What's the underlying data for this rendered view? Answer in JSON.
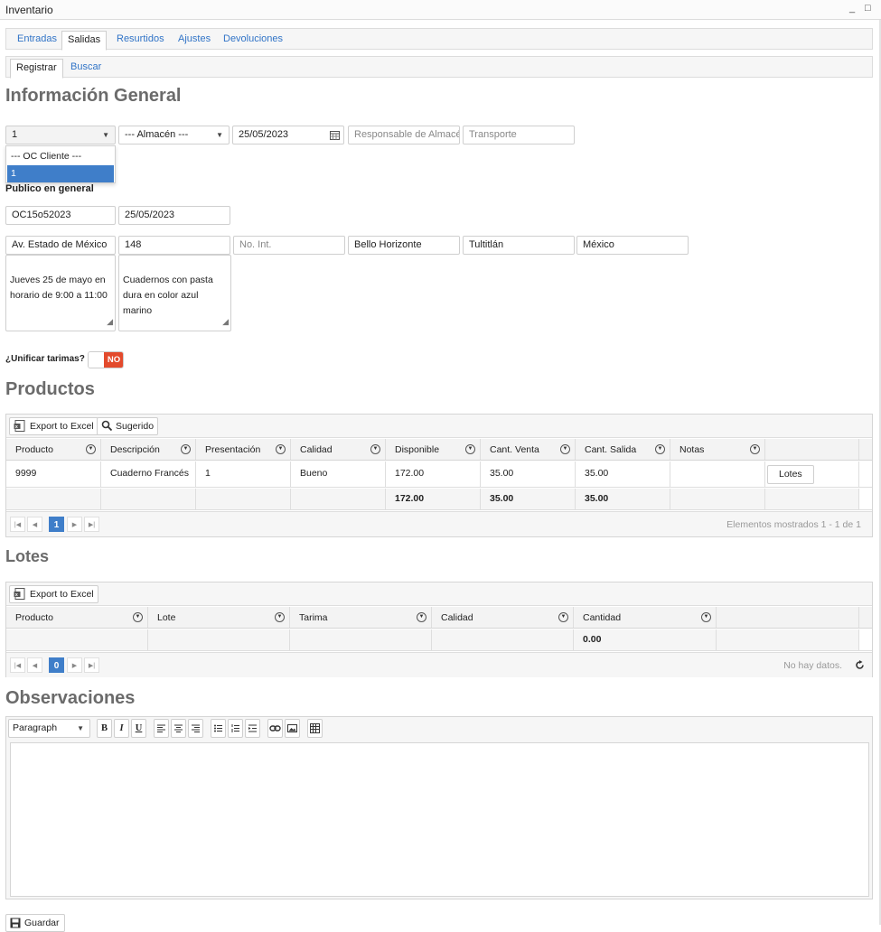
{
  "window": {
    "title": "Inventario",
    "minimize": "_",
    "maximize": "□"
  },
  "tabs": [
    {
      "label": "Entradas"
    },
    {
      "label": "Salidas"
    },
    {
      "label": "Resurtidos"
    },
    {
      "label": "Ajustes"
    },
    {
      "label": "Devoluciones"
    }
  ],
  "subtabs": [
    {
      "label": "Registrar"
    },
    {
      "label": "Buscar"
    }
  ],
  "sections": {
    "general": "Información General",
    "productos": "Productos",
    "lotes": "Lotes",
    "observaciones": "Observaciones"
  },
  "form": {
    "oc_select": "1",
    "almacen": "--- Almacén ---",
    "fecha": "25/05/2023",
    "responsable_placeholder": "Responsable de Almacén",
    "transporte_placeholder": "Transporte",
    "dropdown_options": [
      "--- OC Cliente ---",
      "1"
    ],
    "cliente": "Publico en general",
    "oc_numero": "OC15o52023",
    "fecha_oc": "25/05/2023",
    "calle": "Av. Estado de México",
    "num_ext": "148",
    "num_int_placeholder": "No. Int.",
    "colonia": "Bello Horizonte",
    "municipio": "Tultitlán",
    "estado": "México",
    "nota_entrega": "Jueves 25 de mayo en\nhorario de 9:00  a 11:00",
    "nota_producto": "Cuadernos con pasta\ndura en color azul marino",
    "unificar_label": "¿Unificar tarimas?",
    "unificar_value": "NO"
  },
  "productos": {
    "toolbar": {
      "export": "Export to Excel",
      "sugerido": "Sugerido"
    },
    "columns": [
      "Producto",
      "Descripción",
      "Presentación",
      "Calidad",
      "Disponible",
      "Cant. Venta",
      "Cant. Salida",
      "Notas"
    ],
    "rows": [
      {
        "producto": "9999",
        "descripcion": "Cuaderno Francés",
        "presentacion": "1",
        "calidad": "Bueno",
        "disponible": "172.00",
        "venta": "35.00",
        "salida": "35.00",
        "notas": "",
        "action": "Lotes"
      }
    ],
    "totals": {
      "disponible": "172.00",
      "venta": "35.00",
      "salida": "35.00"
    },
    "pager": {
      "page": "1",
      "info": "Elementos mostrados 1 - 1 de 1"
    }
  },
  "lotes": {
    "toolbar": {
      "export": "Export to Excel"
    },
    "columns": [
      "Producto",
      "Lote",
      "Tarima",
      "Calidad",
      "Cantidad"
    ],
    "totals": {
      "cantidad": "0.00"
    },
    "pager": {
      "page": "0",
      "info": "No hay datos."
    }
  },
  "editor": {
    "format": "Paragraph",
    "tools": [
      "B",
      "I",
      "U"
    ]
  },
  "actions": {
    "save": "Guardar"
  },
  "colors": {
    "accent": "#3f7ec9",
    "toggle_off": "#e34a2c",
    "link": "#3174c7"
  }
}
